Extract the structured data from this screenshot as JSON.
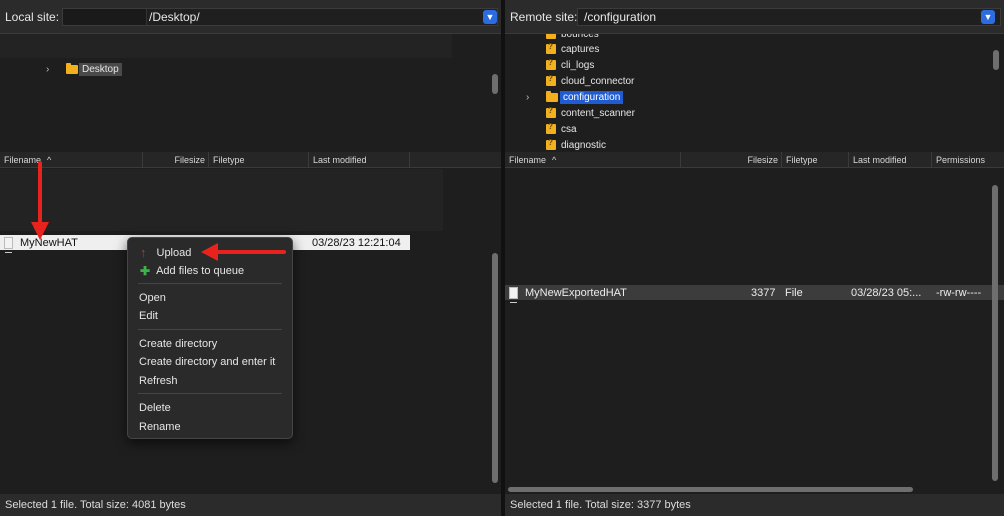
{
  "local": {
    "site_label": "Local site:",
    "path": "/Desktop/",
    "tree_items": [
      {
        "label": "Desktop"
      }
    ],
    "columns": {
      "filename": "Filename",
      "filesize": "Filesize",
      "filetype": "Filetype",
      "last_modified": "Last modified"
    },
    "files": [
      {
        "name": "MyNewHAT",
        "modified": "03/28/23 12:21:04"
      }
    ],
    "status": "Selected 1 file. Total size: 4081 bytes"
  },
  "remote": {
    "site_label": "Remote site:",
    "path": "/configuration",
    "tree_items": [
      {
        "label": "bounces"
      },
      {
        "label": "captures"
      },
      {
        "label": "cli_logs"
      },
      {
        "label": "cloud_connector"
      },
      {
        "label": "configuration"
      },
      {
        "label": "content_scanner"
      },
      {
        "label": "csa"
      },
      {
        "label": "diagnostic"
      }
    ],
    "columns": {
      "filename": "Filename",
      "filesize": "Filesize",
      "filetype": "Filetype",
      "last_modified": "Last modified",
      "permissions": "Permissions"
    },
    "files": [
      {
        "name": "MyNewExportedHAT",
        "size": "3377",
        "type": "File",
        "modified": "03/28/23 05:...",
        "permissions": "-rw-rw----"
      }
    ],
    "status": "Selected 1 file. Total size: 3377 bytes"
  },
  "context_menu": {
    "upload": "Upload",
    "add_to_queue": "Add files to queue",
    "open": "Open",
    "edit": "Edit",
    "create_directory": "Create directory",
    "create_directory_enter": "Create directory and enter it",
    "refresh": "Refresh",
    "delete": "Delete",
    "rename": "Rename"
  },
  "colors": {
    "accent": "#2c6be0",
    "arrow": "#e8231d",
    "folder": "#f2b01e"
  }
}
